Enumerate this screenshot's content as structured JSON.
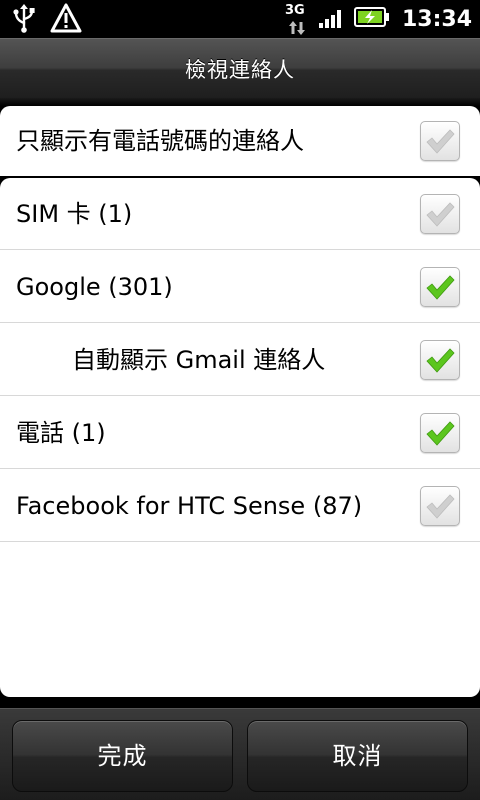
{
  "status_bar": {
    "network_type": "3G",
    "time": "13:34",
    "icons": [
      "usb-icon",
      "warning-icon",
      "data-arrows-icon",
      "signal-icon",
      "battery-charging-icon"
    ],
    "colors": {
      "battery": "#7ed321"
    }
  },
  "dialog": {
    "title": "檢視連絡人"
  },
  "options": {
    "phone_only": {
      "label": "只顯示有電話號碼的連絡人",
      "checked": false
    }
  },
  "accounts": [
    {
      "label": "SIM 卡 (1)",
      "checked": false,
      "indent": false
    },
    {
      "label": "Google (301)",
      "checked": true,
      "indent": false
    },
    {
      "label": "自動顯示 Gmail 連絡人",
      "checked": true,
      "indent": true
    },
    {
      "label": "電話 (1)",
      "checked": true,
      "indent": false
    },
    {
      "label": "Facebook for HTC Sense (87)",
      "checked": false,
      "indent": false
    }
  ],
  "buttons": {
    "done": "完成",
    "cancel": "取消"
  },
  "colors": {
    "check_on": "#5cc61e",
    "check_off": "#cfcfcf"
  }
}
